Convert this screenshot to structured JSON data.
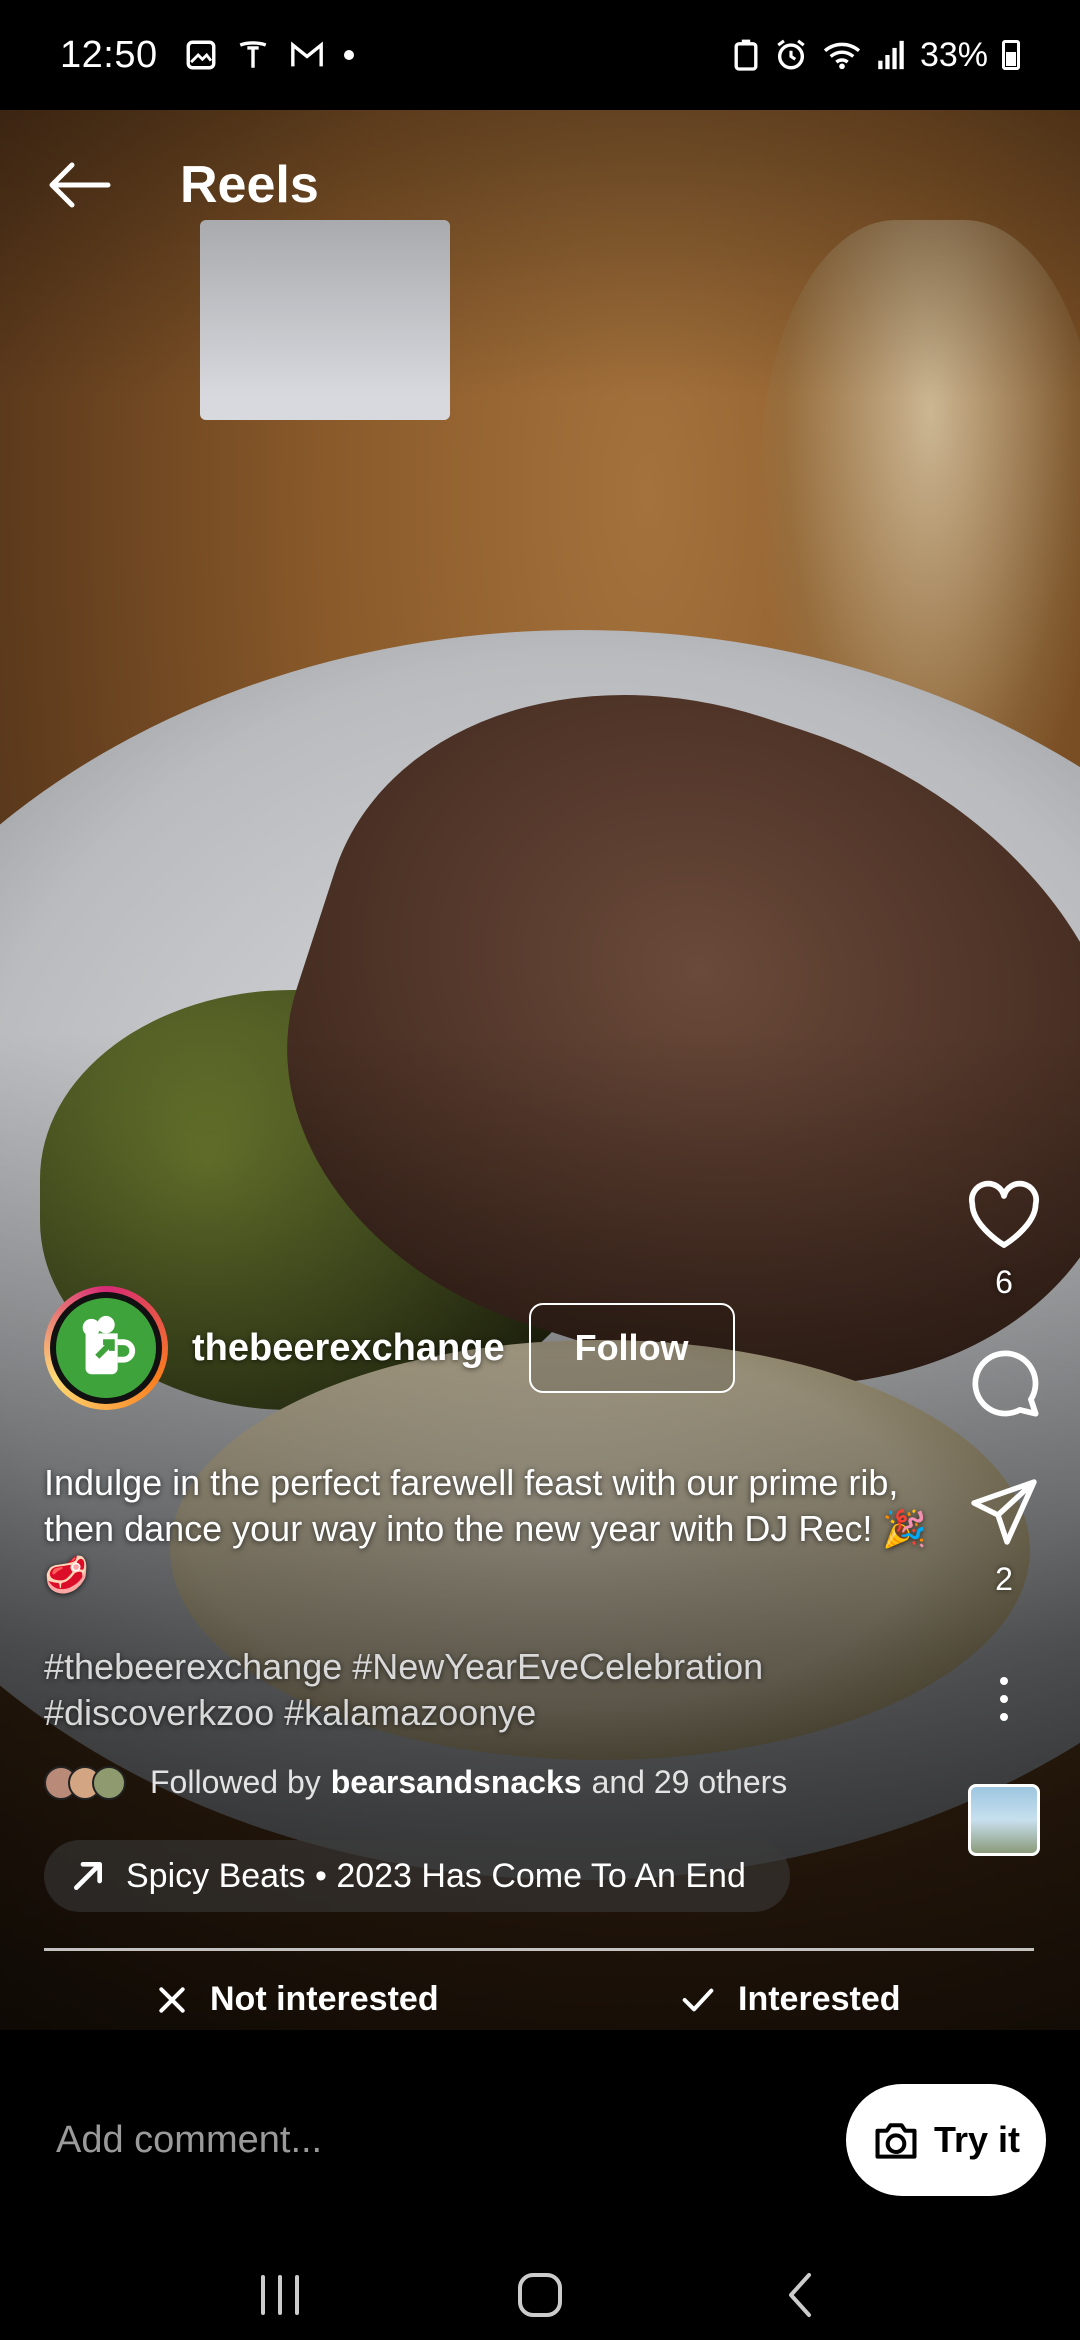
{
  "status_bar": {
    "time": "12:50",
    "battery": "33%"
  },
  "header": {
    "title": "Reels"
  },
  "post": {
    "username": "thebeerexchange",
    "follow_label": "Follow",
    "caption": "Indulge in the perfect farewell feast with our prime rib, then dance your way into the new year with DJ Rec! 🎉🥩",
    "hashtags": "#thebeerexchange #NewYearEveCelebration #discoverkzoo #kalamazoonye",
    "followed_prefix": "Followed by",
    "followed_user": "bearsandsnacks",
    "followed_suffix": "and 29 others",
    "audio": "Spicy Beats • 2023 Has Come To An End"
  },
  "actions": {
    "likes": "6",
    "shares": "2"
  },
  "interest": {
    "not_interested": "Not interested",
    "interested": "Interested"
  },
  "comment_bar": {
    "placeholder": "Add comment...",
    "try_label": "Try it"
  }
}
